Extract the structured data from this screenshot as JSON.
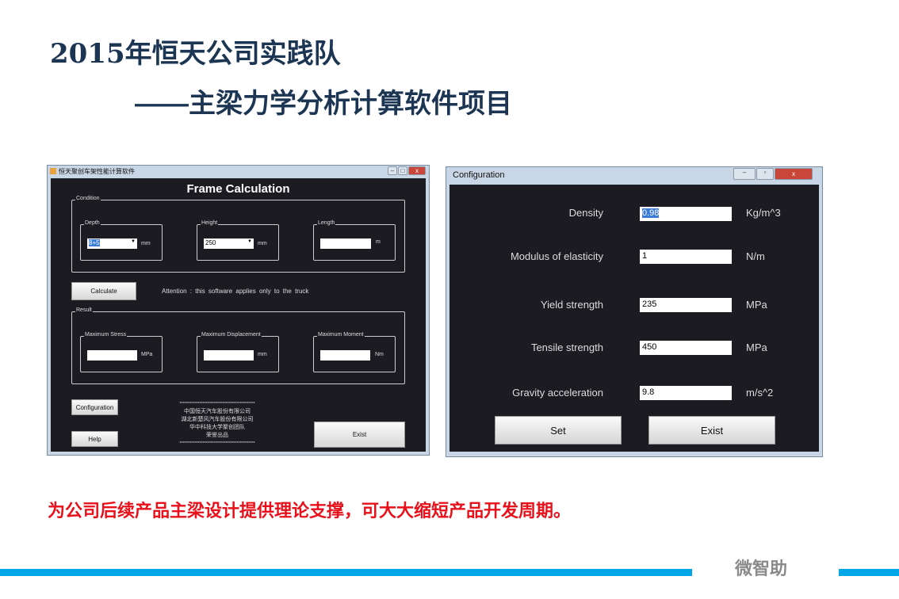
{
  "slide": {
    "title1": "2015年恒天公司实践队",
    "title2": "——主梁力学分析计算软件项目",
    "summary": "为公司后续产品主梁设计提供理论支撑，可大大缩短产品开发周期。",
    "footer_brand": "微智助",
    "accent": "#00a6e6"
  },
  "frame_window": {
    "title": "恒天聚创车架性能计算软件",
    "heading": "Frame Calculation",
    "condition_label": "Condition",
    "depth": {
      "label": "Depth",
      "value": "8+5",
      "unit": "mm"
    },
    "height": {
      "label": "Height",
      "value": "250",
      "unit": "mm"
    },
    "length": {
      "label": "Length",
      "value": "",
      "unit": "m"
    },
    "calculate": "Calculate",
    "attention": "Attention : this software applies only to the truck",
    "result_label": "Result",
    "max_stress": {
      "label": "Maximum Stress",
      "value": "",
      "unit": "MPa"
    },
    "max_displacement": {
      "label": "Maximum Displacement",
      "value": "",
      "unit": "mm"
    },
    "max_moment": {
      "label": "Maximum Moment",
      "value": "",
      "unit": "Nm"
    },
    "configuration": "Configuration",
    "help": "Help",
    "exist": "Exist",
    "stars": "*************************************************",
    "credits": [
      "中国恒天汽车股份有限公司",
      "湖北新楚风汽车股份有限公司",
      "华中科技大学聚创团队",
      "荣誉出品"
    ]
  },
  "config_window": {
    "title": "Configuration",
    "fields": [
      {
        "label": "Density",
        "value": "0.98",
        "unit": "Kg/m^3"
      },
      {
        "label": "Modulus of elasticity",
        "value": "1",
        "unit": "N/m"
      },
      {
        "label": "Yield strength",
        "value": "235",
        "unit": "MPa"
      },
      {
        "label": "Tensile strength",
        "value": "450",
        "unit": "MPa"
      },
      {
        "label": "Gravity acceleration",
        "value": "9.8",
        "unit": "m/s^2"
      }
    ],
    "set": "Set",
    "exist": "Exist"
  }
}
